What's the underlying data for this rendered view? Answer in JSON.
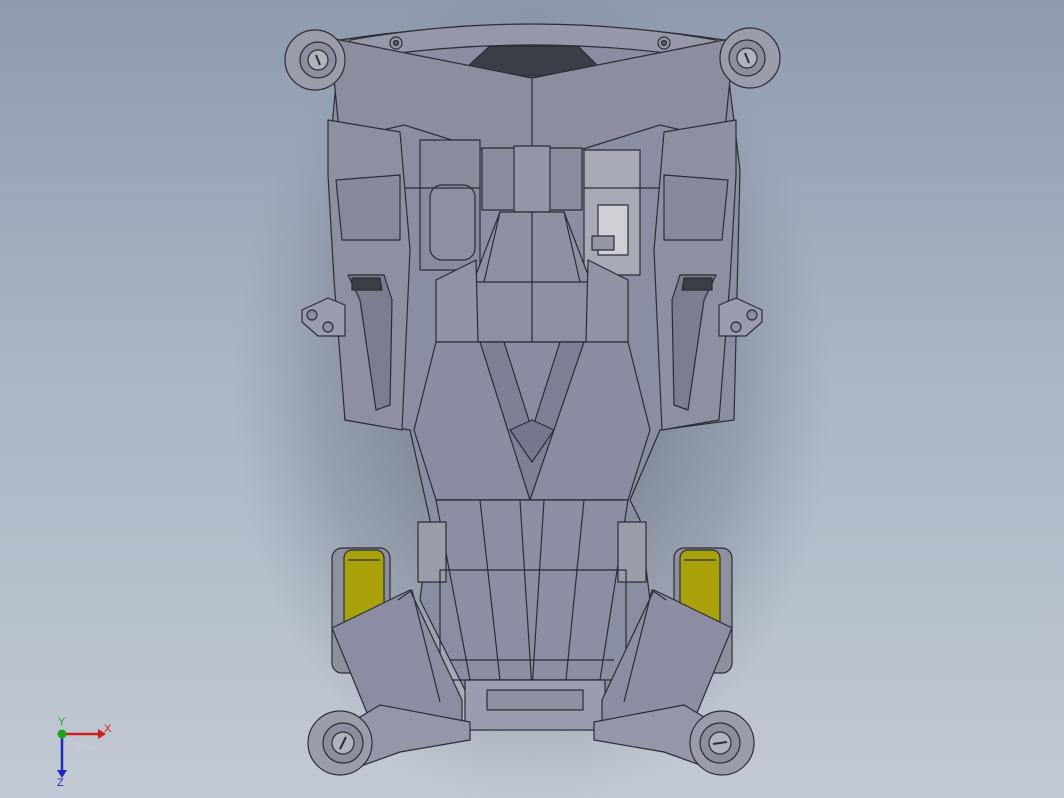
{
  "viewport": {
    "background_top": "#8e9aae",
    "background_bottom": "#c2c9d4"
  },
  "model": {
    "body_color": "#8a8ea2",
    "edge_color": "#2a2c36",
    "tire_color": "#a9a10a",
    "wheel_color": "#9a9caa"
  },
  "triad": {
    "x_label": "X",
    "y_label": "Y",
    "z_label": "Z",
    "x_color": "#d21d1d",
    "y_color": "#1fa31f",
    "z_color": "#1f2ab8"
  }
}
